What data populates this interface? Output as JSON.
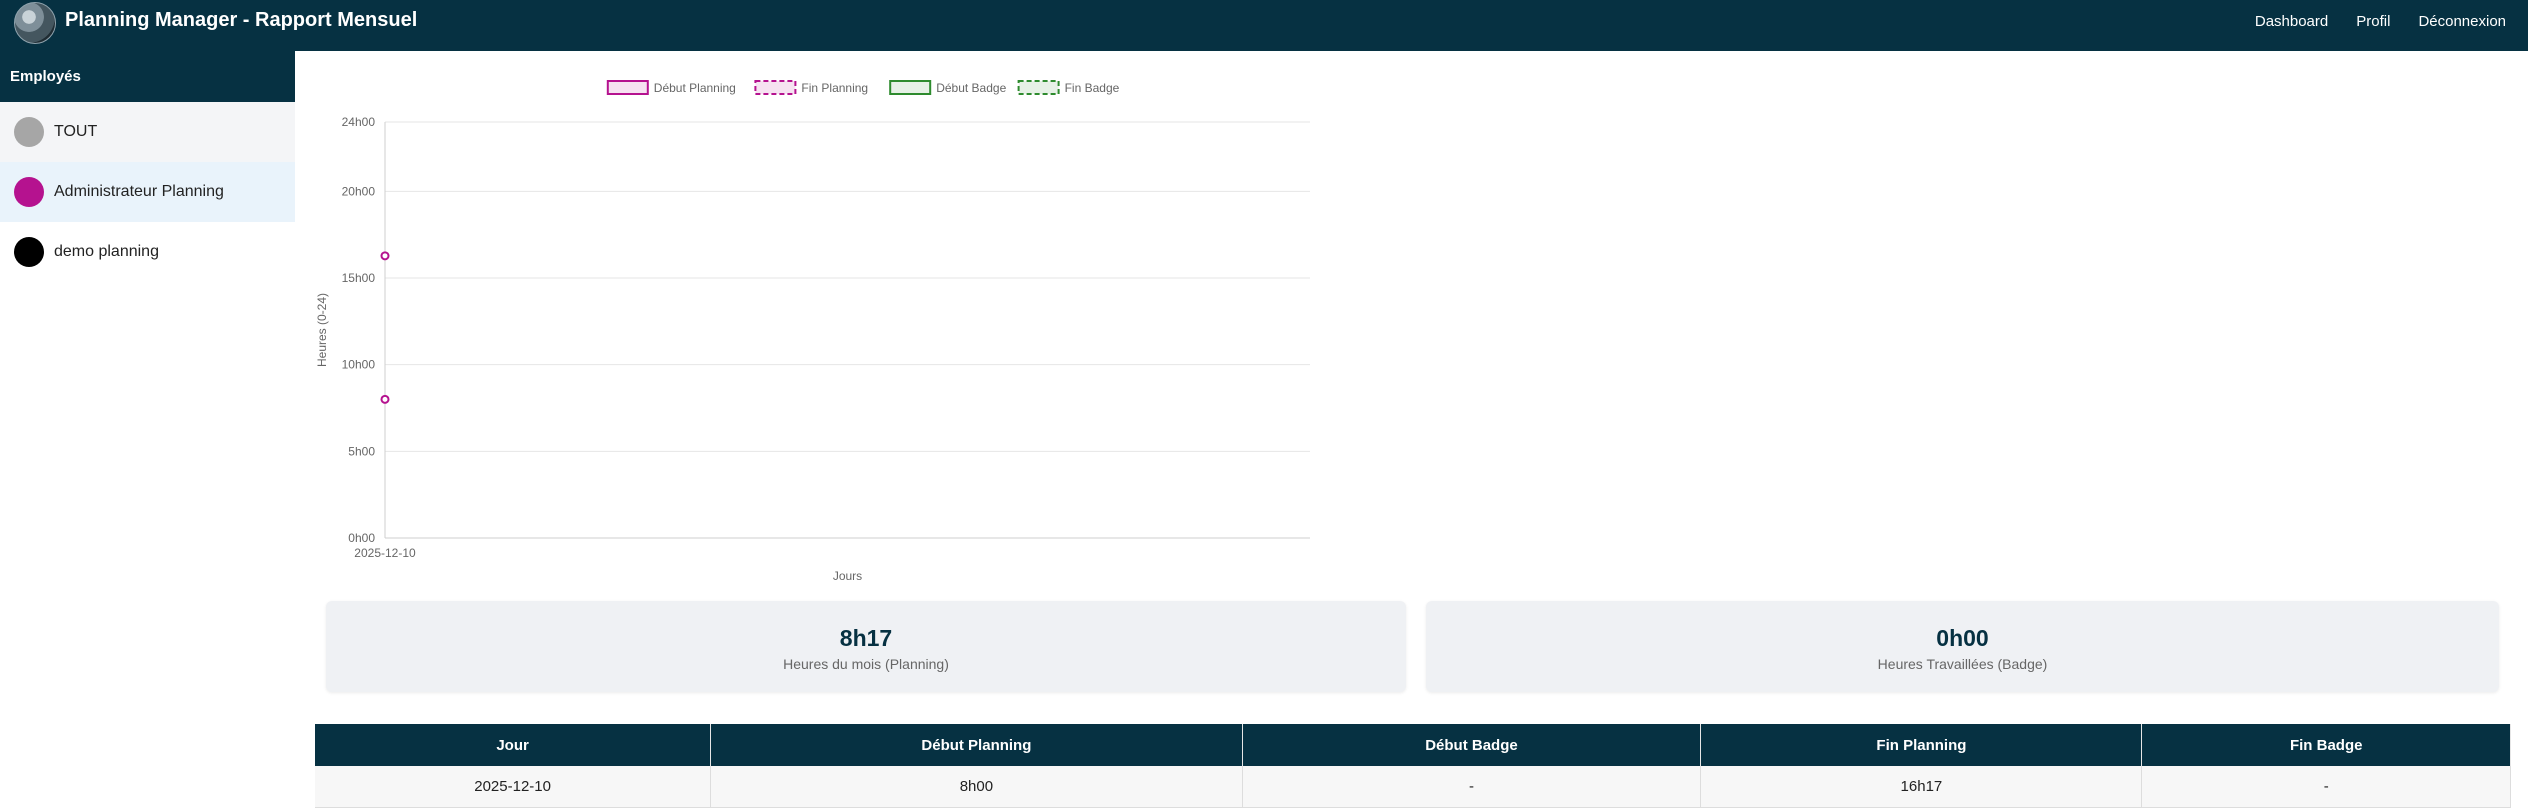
{
  "app": {
    "title": "Planning Manager - Rapport Mensuel"
  },
  "nav": {
    "dashboard": "Dashboard",
    "profile": "Profil",
    "logout": "Déconnexion"
  },
  "sidebar": {
    "title": "Employés",
    "employees": [
      {
        "name": "TOUT",
        "color": "#a6a6a6"
      },
      {
        "name": "Administrateur Planning",
        "color": "#b5128f"
      },
      {
        "name": "demo planning",
        "color": "#000000"
      }
    ]
  },
  "chart_data": {
    "type": "line",
    "xlabel": "Jours",
    "ylabel": "Heures (0-24)",
    "ylim": [
      0,
      24
    ],
    "yticks": [
      "0h00",
      "5h00",
      "10h00",
      "15h00",
      "20h00",
      "24h00"
    ],
    "x": [
      "2025-12-10"
    ],
    "legend_position": "top",
    "series": [
      {
        "name": "Début Planning",
        "color": "#b5128f",
        "dashed": false,
        "values": [
          8.0
        ]
      },
      {
        "name": "Fin Planning",
        "color": "#b5128f",
        "dashed": true,
        "values": [
          16.28
        ]
      },
      {
        "name": "Début Badge",
        "color": "#2e8b2e",
        "dashed": false,
        "values": []
      },
      {
        "name": "Fin Badge",
        "color": "#2e8b2e",
        "dashed": true,
        "values": []
      }
    ]
  },
  "summary": {
    "planning_hours": {
      "value": "8h17",
      "label": "Heures du mois (Planning)"
    },
    "badge_hours": {
      "value": "0h00",
      "label": "Heures Travaillées (Badge)"
    }
  },
  "table": {
    "headers": [
      "Jour",
      "Début Planning",
      "Début Badge",
      "Fin Planning",
      "Fin Badge"
    ],
    "rows": [
      [
        "2025-12-10",
        "8h00",
        "-",
        "16h17",
        "-"
      ]
    ]
  }
}
